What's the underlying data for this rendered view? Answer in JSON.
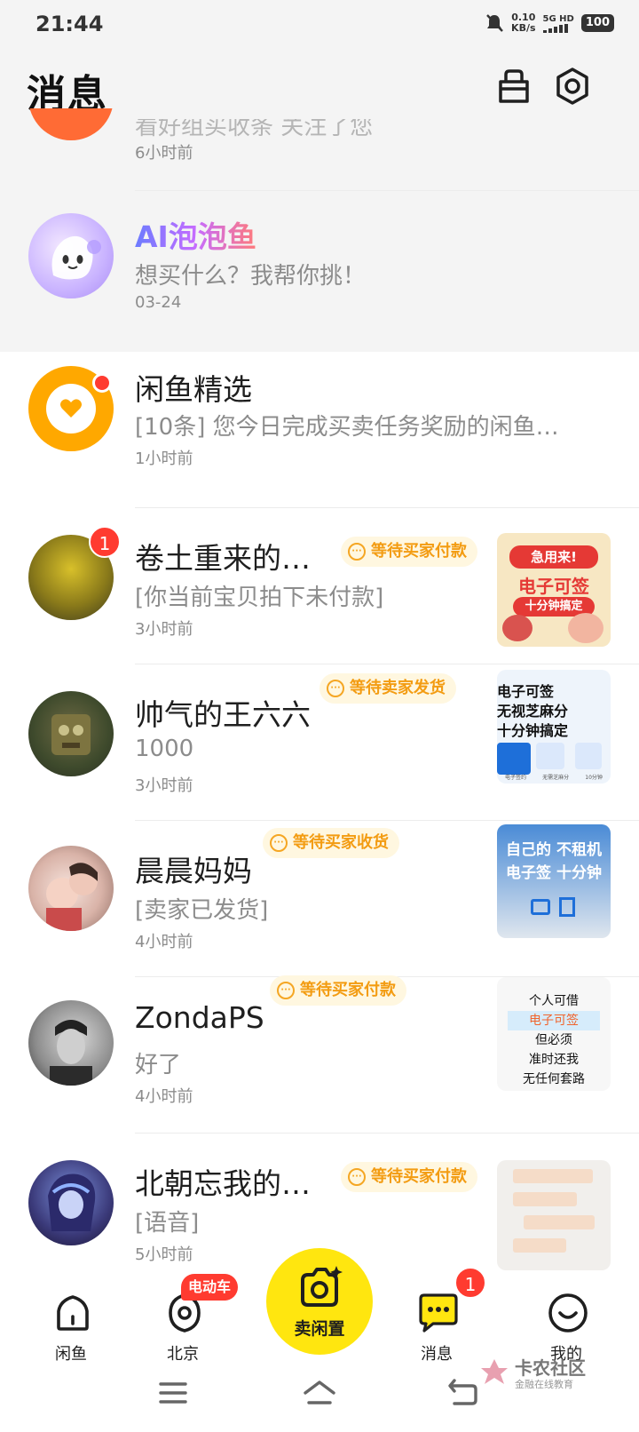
{
  "status_bar": {
    "time": "21:44",
    "net_speed_value": "0.10",
    "net_speed_unit": "KB/s",
    "network": "5G HD",
    "battery": "100"
  },
  "header": {
    "title": "消息",
    "icons": [
      "bag-icon",
      "settings-icon"
    ]
  },
  "top_rows": [
    {
      "name": "",
      "preview": "看好组买收条 关注了您",
      "time": "6小时前"
    },
    {
      "name": "AI泡泡鱼",
      "preview": "想买什么？我帮你挑！",
      "time": "03-24"
    }
  ],
  "conversations": [
    {
      "name": "闲鱼精选",
      "preview": "[10条] 您今日完成买卖任务奖励的闲鱼…",
      "time": "1小时前",
      "tag": "",
      "unread": ""
    },
    {
      "name": "卷土重来的…",
      "preview": "[你当前宝贝拍下未付款]",
      "time": "3小时前",
      "tag": "等待买家付款",
      "unread": "1"
    },
    {
      "name": "帅气的王六六",
      "preview": "1000",
      "time": "3小时前",
      "tag": "等待卖家发货",
      "unread": ""
    },
    {
      "name": "晨晨妈妈",
      "preview": "[卖家已发货]",
      "time": "4小时前",
      "tag": "等待买家收货",
      "unread": ""
    },
    {
      "name": "ZondaPS",
      "preview": "好了",
      "time": "4小时前",
      "tag": "等待买家付款",
      "unread": ""
    },
    {
      "name": "北朝忘我的…",
      "preview": "[语音]",
      "time": "5小时前",
      "tag": "等待买家付款",
      "unread": ""
    }
  ],
  "thumbnails": {
    "t1": {
      "line1": "急用来!",
      "line2": "电子可签",
      "line3": "十分钟搞定"
    },
    "t2": {
      "line1": "电子可签",
      "line2": "无视芝麻分",
      "line3": "十分钟搞定",
      "cap1": "电子签约",
      "cap2": "无需芝麻分",
      "cap3": "10分钟"
    },
    "t3": {
      "line1": "自己的 不租机",
      "line2": "电子签 十分钟"
    },
    "t4": {
      "line1": "个人可借",
      "line2": "电子可签",
      "line3": "但必须",
      "line4": "准时还我",
      "line5": "无任何套路"
    }
  },
  "bottom_nav": {
    "home": "闲鱼",
    "city": "北京",
    "city_badge": "电动车",
    "sell": "卖闲置",
    "messages": "消息",
    "messages_badge": "1",
    "me": "我的"
  },
  "watermark": {
    "title": "卡农社区",
    "subtitle": "金融在线教育"
  },
  "colors": {
    "accent_yellow": "#ffe60f",
    "tag_text": "#f39c12",
    "tag_bg": "#fff7e0",
    "badge_red": "#ff3b30"
  }
}
